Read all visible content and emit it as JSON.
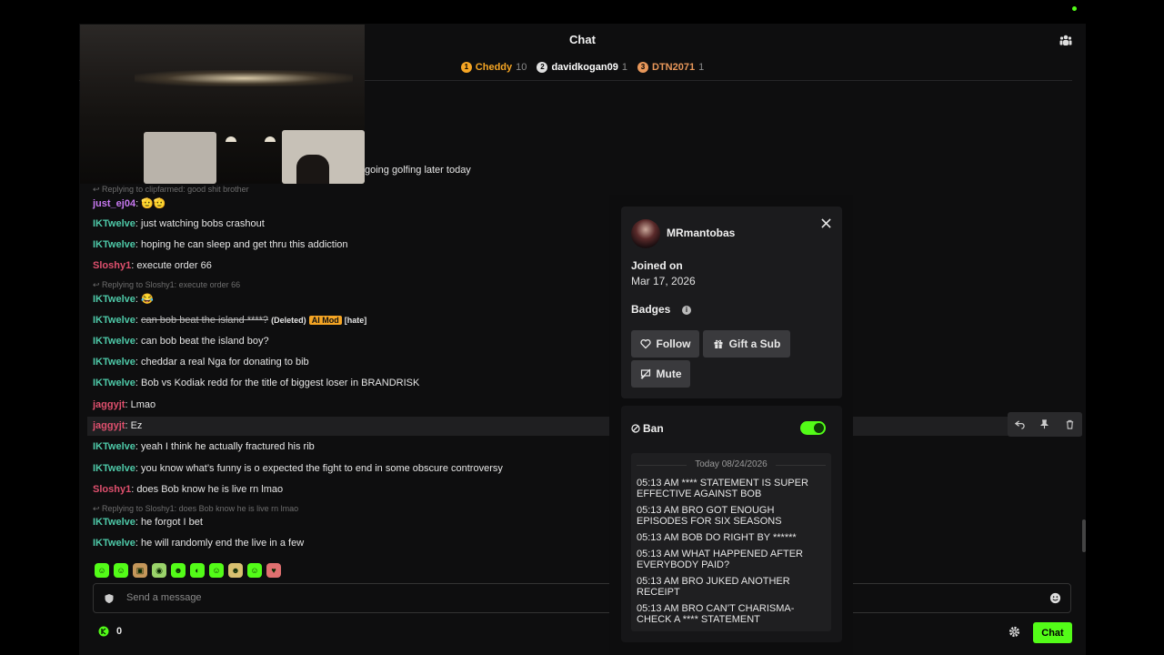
{
  "header": {
    "title": "Chat"
  },
  "leaderboard": [
    {
      "rank": "1",
      "name": "Cheddy",
      "count": "10",
      "color": "#f5a524"
    },
    {
      "rank": "2",
      "name": "davidkogan09",
      "count": "1",
      "color": "#ffffff"
    },
    {
      "rank": "3",
      "name": "DTN2071",
      "count": "1",
      "color": "#e8975a"
    }
  ],
  "messages": [
    {
      "tail": "going golfing later today"
    },
    {
      "reply": "Replying to clipfarmed: good shit brother",
      "user": "just_ej04",
      "color": "#c879f2",
      "text": "🫡🫡"
    },
    {
      "user": "IKTwelve",
      "color": "#4ec9a8",
      "text": "just watching bobs crashout"
    },
    {
      "user": "IKTwelve",
      "color": "#4ec9a8",
      "text": "hoping he can sleep and get thru this addiction"
    },
    {
      "user": "Sloshy1",
      "color": "#e0506e",
      "text": "execute order 66"
    },
    {
      "reply": "Replying to Sloshy1: execute order 66",
      "user": "IKTwelve",
      "color": "#4ec9a8",
      "text": "😂"
    },
    {
      "user": "IKTwelve",
      "color": "#4ec9a8",
      "text": "can bob beat the island ****?",
      "deleted": "(Deleted)",
      "badge": "AI Mod",
      "tag": "[hate]"
    },
    {
      "user": "IKTwelve",
      "color": "#4ec9a8",
      "text": "can bob beat the island boy?"
    },
    {
      "user": "IKTwelve",
      "color": "#4ec9a8",
      "text": "cheddar a real Nga for donating to bib"
    },
    {
      "user": "IKTwelve",
      "color": "#4ec9a8",
      "text": "Bob vs Kodiak redd for the title of biggest loser in BRANDRISK"
    },
    {
      "user": "jaggyjt",
      "color": "#e0506e",
      "text": "Lmao"
    },
    {
      "user": "jaggyjt",
      "color": "#e0506e",
      "text": "Ez"
    },
    {
      "user": "IKTwelve",
      "color": "#4ec9a8",
      "text": "yeah I think he actually fractured his rib"
    },
    {
      "user": "IKTwelve",
      "color": "#4ec9a8",
      "text": "you know what’s funny is o expected the fight to end in some obscure controversy"
    },
    {
      "user": "Sloshy1",
      "color": "#e0506e",
      "text": "does Bob know he is live rn lmao"
    },
    {
      "reply": "Replying to Sloshy1: does Bob know he is live rn lmao",
      "user": "IKTwelve",
      "color": "#4ec9a8",
      "text": "he forgot I bet"
    },
    {
      "user": "IKTwelve",
      "color": "#4ec9a8",
      "text": "he will randomly end the live in a few"
    }
  ],
  "input": {
    "placeholder": "Send a message"
  },
  "points": {
    "value": "0"
  },
  "chat_button": "Chat",
  "profile": {
    "username": "MRmantobas",
    "joined_label": "Joined on",
    "joined_date": "Mar 17, 2026",
    "badges_label": "Badges",
    "follow": "Follow",
    "gift": "Gift a Sub",
    "mute": "Mute"
  },
  "moderation": {
    "ban_label": "Ban",
    "ban_enabled": true,
    "day": "Today 08/24/2026",
    "history": [
      "05:13 AM **** STATEMENT IS SUPER EFFECTIVE AGAINST BOB",
      "05:13 AM BRO GOT ENOUGH EPISODES FOR SIX SEASONS",
      "05:13 AM BOB DO RIGHT BY ******",
      "05:13 AM WHAT HAPPENED AFTER EVERYBODY PAID?",
      "05:13 AM BRO JUKED ANOTHER RECEIPT",
      "05:13 AM BRO CAN’T CHARISMA-CHECK A **** STATEMENT"
    ]
  },
  "colors": {
    "accent": "#53fc18",
    "background": "#0e0e0f"
  }
}
